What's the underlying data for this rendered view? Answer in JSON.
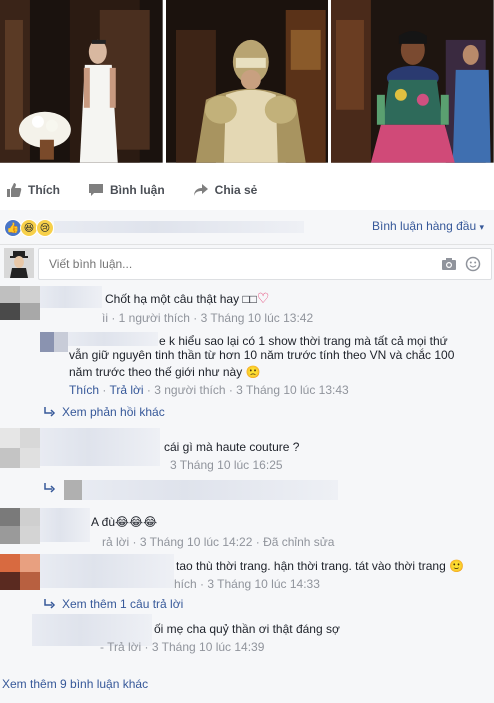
{
  "actions": {
    "like": "Thích",
    "comment": "Bình luận",
    "share": "Chia sẻ"
  },
  "reactions": {
    "sort_label": "Bình luận hàng đầu",
    "sort_caret": "▾"
  },
  "composer": {
    "placeholder": "Viết bình luận..."
  },
  "comments": [
    {
      "text": "Chốt hạ một câu thật hay □□",
      "heart": "♡",
      "meta": "ìi · 1 người thích · 3 Tháng 10 lúc 13:42"
    },
    {
      "text1": "e k hiểu sao lại có 1 show thời trang mà tất cả mọi thứ",
      "text2": "vẫn giữ nguyên tinh thần từ hơn 10 năm trước tính theo VN và chắc 100",
      "text3": "năm trước theo thế giới như này",
      "emoji": "🙁",
      "meta_like": "Thích",
      "meta_reply": "Trả lời",
      "meta_rest": "· 3 người thích · 3 Tháng 10 lúc 13:43"
    },
    {
      "view_more": "Xem phản hồi khác"
    },
    {
      "text": "cái gì mà haute couture ?",
      "meta": "3 Tháng 10 lúc 16:25"
    },
    {
      "text": "A đù😂😂😂",
      "meta": "rả lời · 3 Tháng 10 lúc 14:22 · Đã chỉnh sửa"
    },
    {
      "text": "tao thù thời trang. hận thời trang. tát vào thời trang",
      "emoji": "🙂",
      "meta": "hích · 3 Tháng 10 lúc 14:33"
    },
    {
      "view_more": "Xem thêm 1 câu trả lời"
    },
    {
      "text": "ối mẹ cha quỷ thần ơi thật đáng sợ",
      "meta": "- Trả lời · 3 Tháng 10 lúc 14:39"
    }
  ],
  "footer": {
    "more_comments": "Xem thêm 9 bình luận khác"
  }
}
